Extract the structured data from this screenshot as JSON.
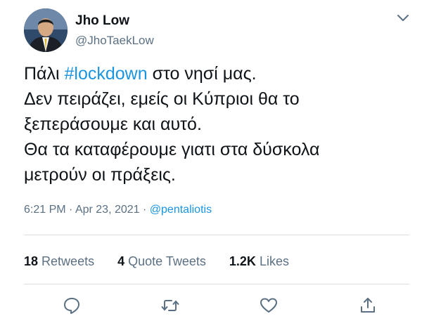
{
  "tweet": {
    "author": {
      "name": "Jho Low",
      "handle": "@JhoTaekLow"
    },
    "body": {
      "line1_before": "Πάλι ",
      "hashtag": "#lockdown",
      "line1_after": " στο νησί μας.",
      "line2": "Δεν πειράζει, εμείς οι Κύπριοι θα το",
      "line3": "ξεπεράσουμε και αυτό.",
      "line4": "Θα τα καταφέρουμε γιατι στα δύσκολα",
      "line5": "μετρούν οι πράξεις."
    },
    "meta": {
      "time": "6:21 PM",
      "sep1": " · ",
      "date": "Apr 23, 2021",
      "sep2": " · ",
      "via": "@pentaliotis"
    },
    "stats": {
      "retweets_count": "18",
      "retweets_label": "Retweets",
      "quotes_count": "4",
      "quotes_label": "Quote Tweets",
      "likes_count": "1.2K",
      "likes_label": "Likes"
    },
    "icons": {
      "caret": "chevron-down-icon",
      "reply": "reply-icon",
      "retweet": "retweet-icon",
      "like": "heart-icon",
      "share": "share-icon"
    },
    "colors": {
      "link": "#1b95e0",
      "secondary_text": "#5b7083",
      "primary_text": "#0f1419"
    }
  }
}
